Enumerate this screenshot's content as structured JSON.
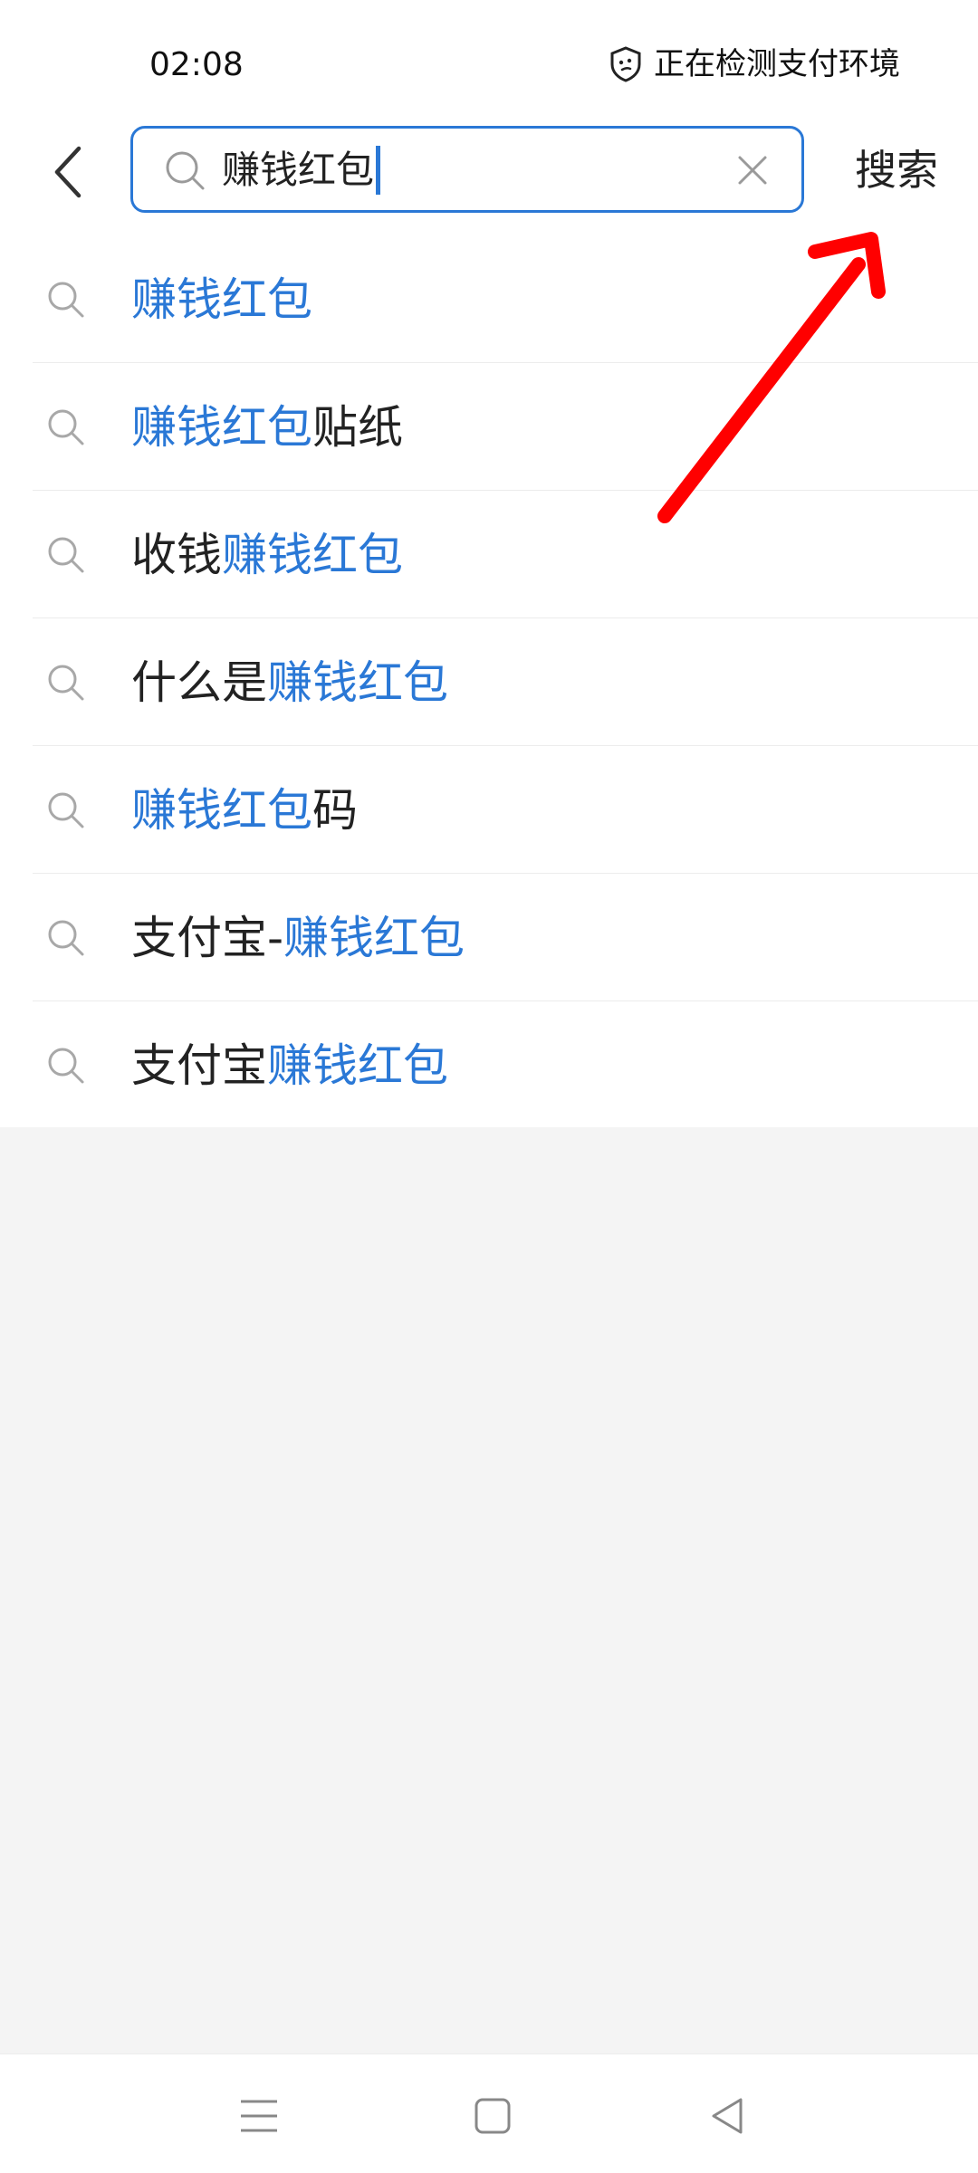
{
  "status_bar": {
    "time": "02:08",
    "security_text": "正在检测支付环境",
    "security_icon": "shield-icon"
  },
  "search": {
    "query": "赚钱红包",
    "search_button_label": "搜索"
  },
  "suggestions": [
    {
      "parts": [
        {
          "text": "赚钱红包",
          "hl": true
        }
      ]
    },
    {
      "parts": [
        {
          "text": "赚钱红包",
          "hl": true
        },
        {
          "text": "贴纸",
          "hl": false
        }
      ]
    },
    {
      "parts": [
        {
          "text": "收钱",
          "hl": false
        },
        {
          "text": "赚钱红包",
          "hl": true
        }
      ]
    },
    {
      "parts": [
        {
          "text": "什么是",
          "hl": false
        },
        {
          "text": "赚钱红包",
          "hl": true
        }
      ]
    },
    {
      "parts": [
        {
          "text": "赚钱红包",
          "hl": true
        },
        {
          "text": "码",
          "hl": false
        }
      ]
    },
    {
      "parts": [
        {
          "text": "支付宝-",
          "hl": false
        },
        {
          "text": "赚钱红包",
          "hl": true
        }
      ]
    },
    {
      "parts": [
        {
          "text": "支付宝",
          "hl": false
        },
        {
          "text": "赚钱红包",
          "hl": true
        }
      ]
    }
  ],
  "colors": {
    "accent": "#2a78d6",
    "annotation": "#ff0000",
    "background": "#f4f4f4"
  },
  "nav_bar": {
    "icons": [
      "menu-icon",
      "home-square-icon",
      "back-triangle-icon"
    ]
  }
}
